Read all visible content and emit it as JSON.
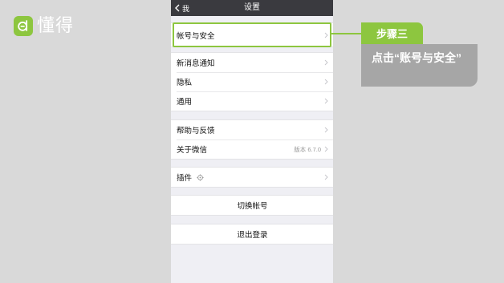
{
  "brand": {
    "name": "懂得",
    "icon": "dongde-logo-icon"
  },
  "colors": {
    "accent": "#8dc63f",
    "page_background": "#d9d9d9",
    "nav_bar": "#3a3a3f",
    "callout": "#a6a6a6"
  },
  "phone": {
    "nav": {
      "back_icon": "chevron-left-icon",
      "back_label": "我",
      "title": "设置"
    },
    "groups": [
      {
        "items": [
          {
            "label": "帐号与安全",
            "highlighted": true
          }
        ]
      },
      {
        "items": [
          {
            "label": "新消息通知"
          },
          {
            "label": "隐私"
          },
          {
            "label": "通用"
          }
        ]
      },
      {
        "items": [
          {
            "label": "帮助与反馈"
          },
          {
            "label": "关于微信",
            "value": "版本 6.7.0"
          }
        ]
      },
      {
        "items": [
          {
            "label": "插件",
            "icon": "gear-icon"
          }
        ]
      }
    ],
    "actions": [
      {
        "label": "切换帐号"
      },
      {
        "label": "退出登录"
      }
    ]
  },
  "callout": {
    "step_label": "步骤三",
    "instruction": "点击“账号与安全”"
  }
}
